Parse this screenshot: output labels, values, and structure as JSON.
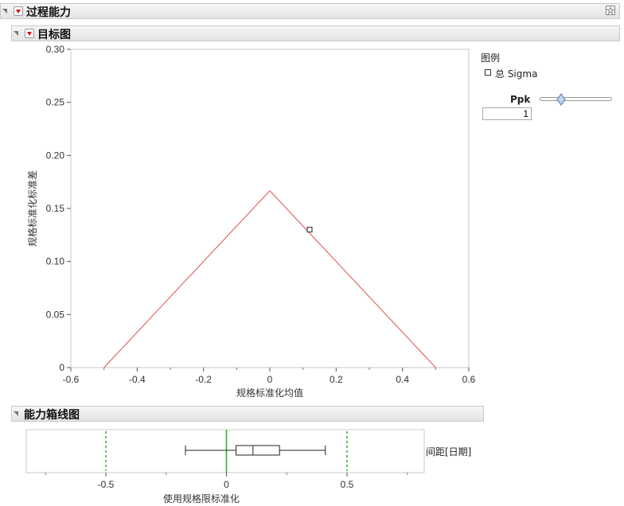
{
  "header": {
    "title": "过程能力"
  },
  "target_plot": {
    "title": "目标图",
    "chart_data": {
      "type": "line",
      "xlabel": "规格标准化均值",
      "ylabel": "规格标准化标准差",
      "xlim": [
        -0.6,
        0.6
      ],
      "ylim": [
        0,
        0.3
      ],
      "x_ticks": [
        "-0.6",
        "-0.4",
        "-0.2",
        "0",
        "0.2",
        "0.4",
        "0.6"
      ],
      "y_ticks": [
        "0.30",
        "0.25",
        "0.20",
        "0.15",
        "0.10",
        "0.05",
        "0"
      ],
      "ppk_boundary": {
        "x": [
          -0.5,
          0,
          0.5
        ],
        "y": [
          0,
          0.1667,
          0
        ],
        "color": "#e05050"
      },
      "points": [
        {
          "series": "总 Sigma",
          "x": 0.12,
          "y": 0.13
        }
      ]
    },
    "legend": {
      "title": "图例",
      "items": [
        {
          "label": "总 Sigma",
          "marker": "open-square"
        }
      ]
    },
    "ppk": {
      "label": "Ppk",
      "value": "1",
      "slider_fraction": 0.29
    }
  },
  "boxplot": {
    "title": "能力箱线图",
    "row_label": "间距[日期]",
    "chart_data": {
      "type": "boxplot",
      "xlabel": "使用规格限标准化",
      "xlim": [
        -0.83,
        0.82
      ],
      "x_ticks": [
        "-0.5",
        "0",
        "0.5"
      ],
      "spec_lines": [
        -0.5,
        0.5
      ],
      "target_line": 0,
      "box": {
        "whisker_low": -0.17,
        "q1": 0.04,
        "median": 0.11,
        "q3": 0.22,
        "whisker_high": 0.41
      }
    }
  }
}
